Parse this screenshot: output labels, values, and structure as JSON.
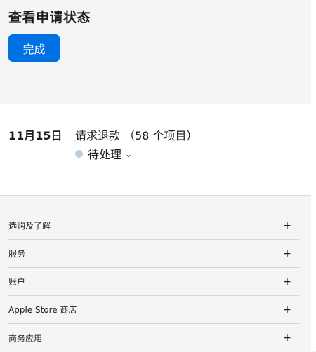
{
  "header": {
    "title": "查看申请状态",
    "done_label": "完成"
  },
  "request": {
    "date": "11月15日",
    "title": "请求退款 （58 个项目）",
    "status": "待处理",
    "status_color": "#b9cfe3"
  },
  "footer": {
    "items": [
      {
        "label": "选购及了解"
      },
      {
        "label": "服务"
      },
      {
        "label": "账户"
      },
      {
        "label": "Apple Store 商店"
      },
      {
        "label": "商务应用"
      }
    ],
    "expand_symbol": "+"
  },
  "colors": {
    "accent": "#0071e3",
    "background": "#f5f5f7"
  }
}
